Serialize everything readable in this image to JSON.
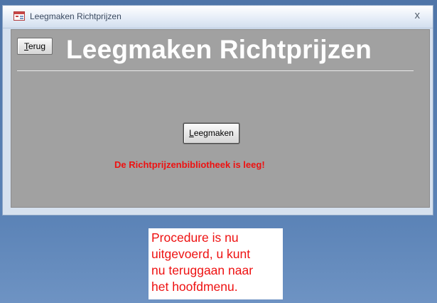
{
  "window": {
    "title": "Leegmaken Richtprijzen",
    "close_glyph": "x",
    "icon": "access-form-icon"
  },
  "form": {
    "back_button": {
      "accel": "T",
      "rest": "erug"
    },
    "header_title": "Leegmaken Richtprijzen",
    "action_button": {
      "accel": "L",
      "rest": "eegmaken"
    },
    "status_message": "De Richtprijzenbibliotheek is leeg!"
  },
  "callout": {
    "lines": [
      "Procedure is nu",
      "uitgevoerd,  u kunt",
      "nu teruggaan naar",
      "het hoofdmenu."
    ]
  },
  "colors": {
    "form_background": "#a1a1a1",
    "header_text": "#ffffff",
    "status_text": "#ee1111",
    "desktop_background": "#5a82b6"
  }
}
